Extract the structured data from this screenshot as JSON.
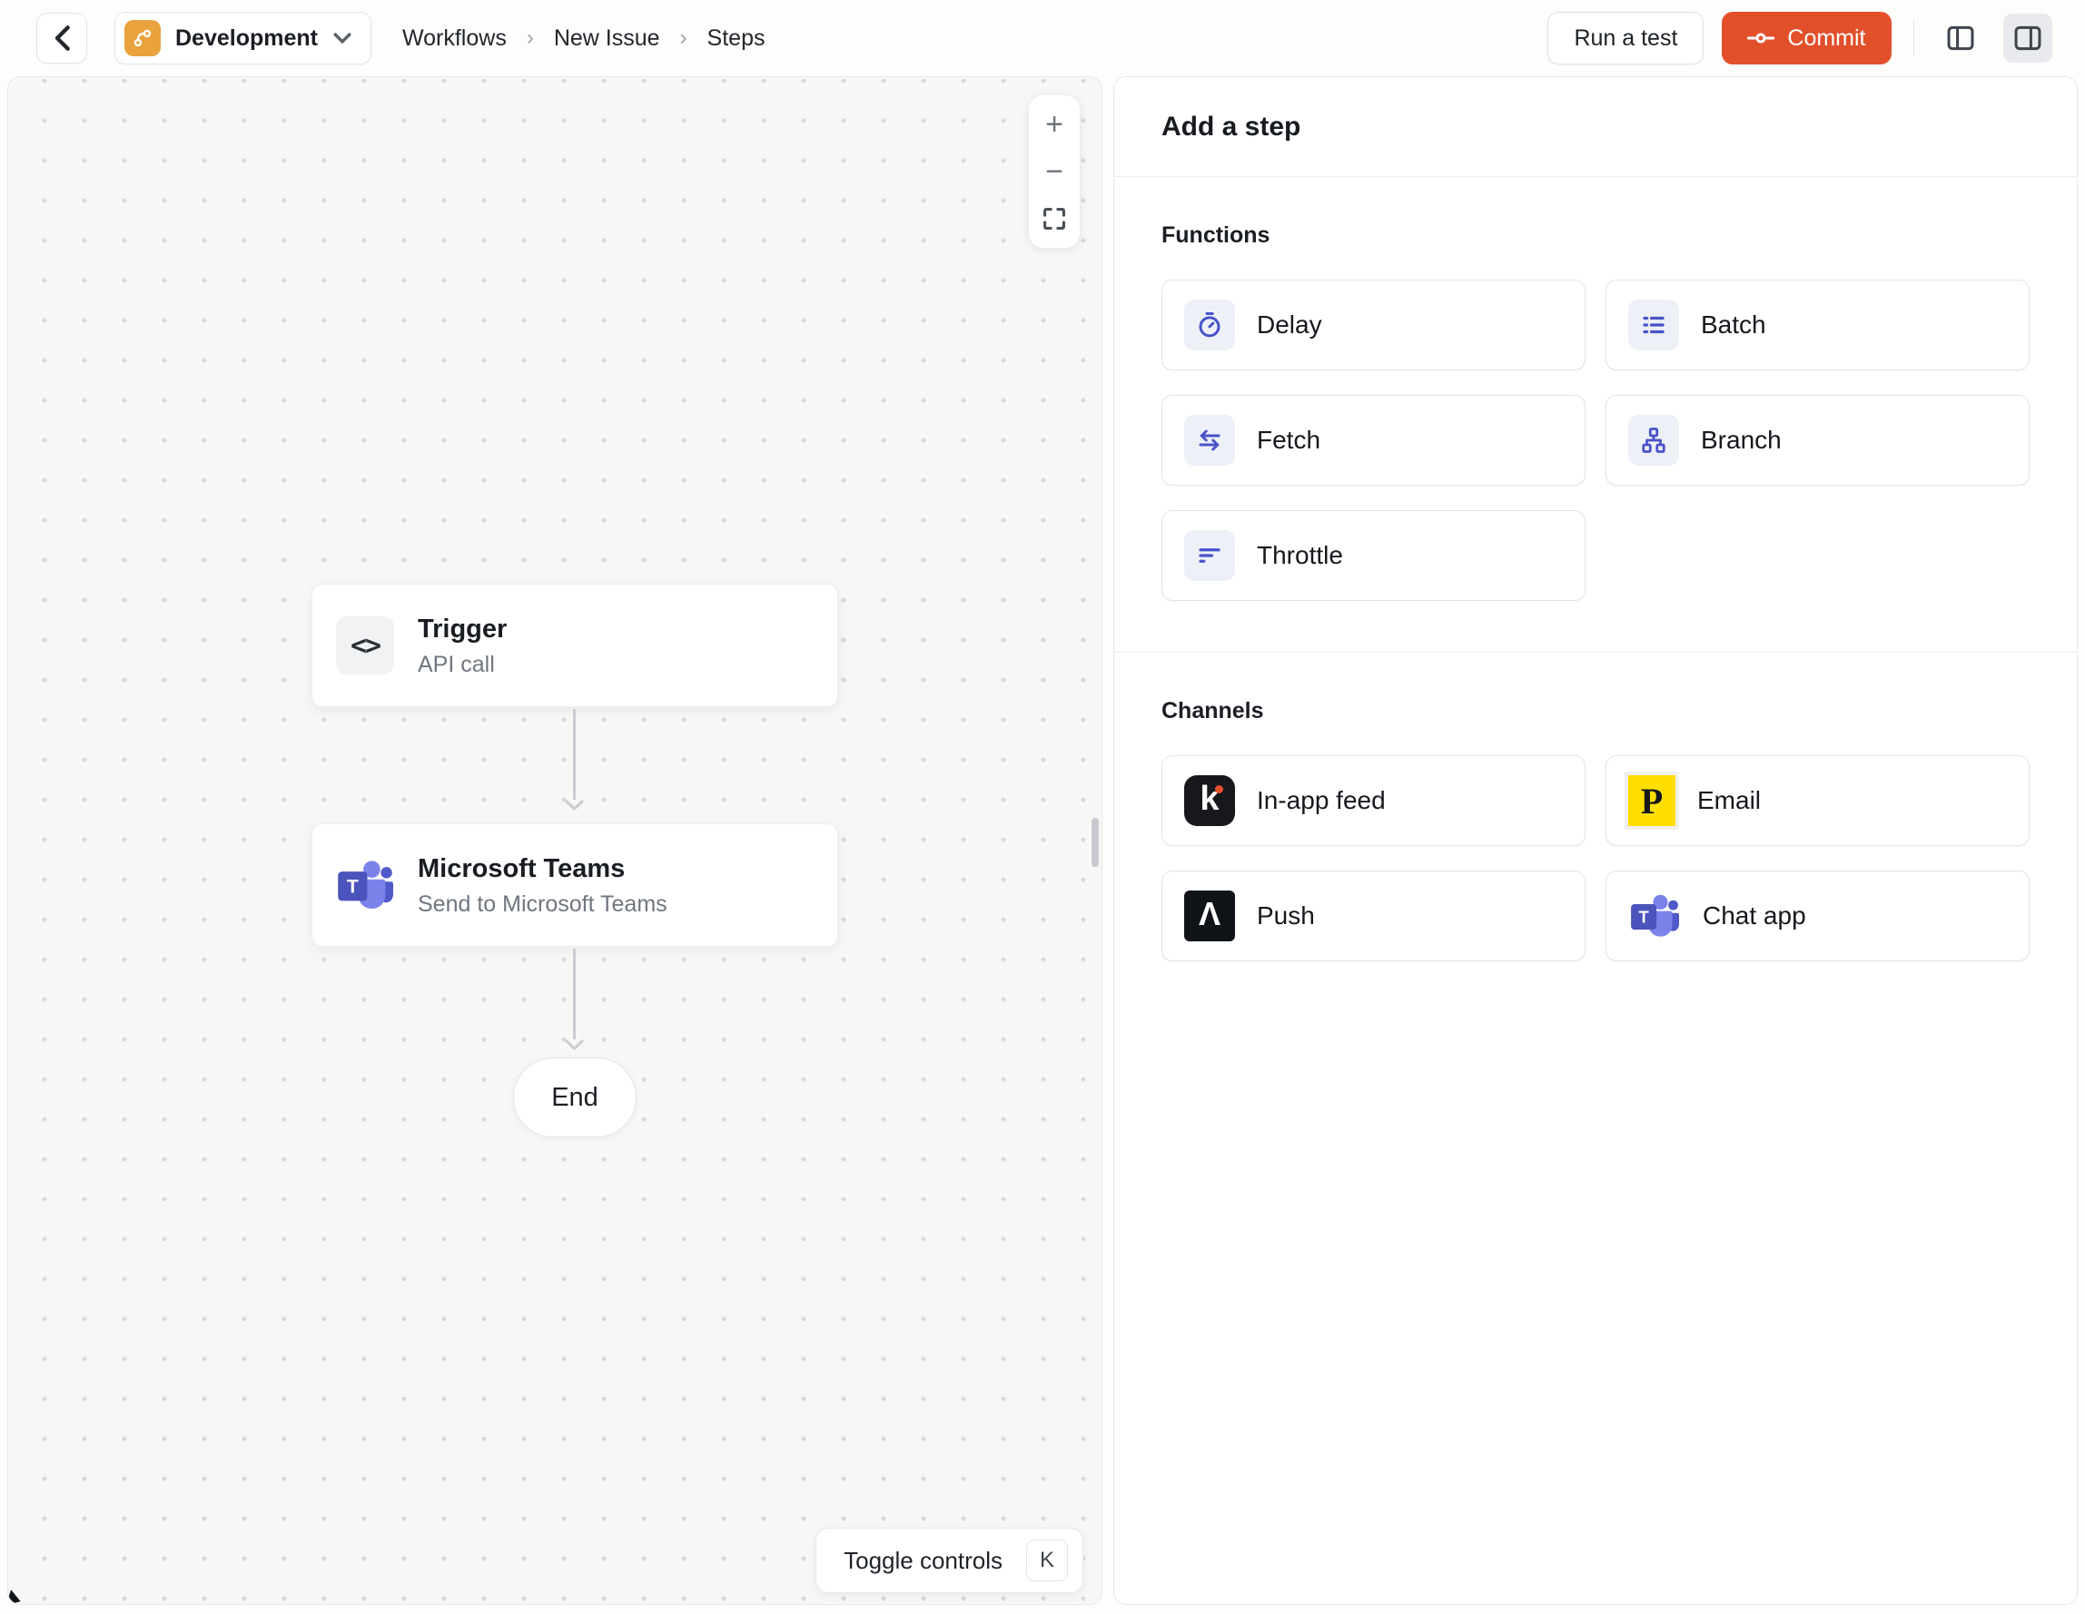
{
  "topbar": {
    "environment": {
      "label": "Development"
    },
    "breadcrumb": [
      "Workflows",
      "New Issue",
      "Steps"
    ],
    "run_test_label": "Run a test",
    "commit_label": "Commit"
  },
  "canvas": {
    "zoom_controls": {
      "zoom_in": "+",
      "zoom_out": "−"
    },
    "nodes": [
      {
        "title": "Trigger",
        "subtitle": "API call",
        "icon": "code-icon"
      },
      {
        "title": "Microsoft Teams",
        "subtitle": "Send to Microsoft Teams",
        "icon": "microsoft-teams-icon"
      }
    ],
    "end_label": "End",
    "toggle_controls": {
      "label": "Toggle controls",
      "shortcut": "K"
    }
  },
  "panel": {
    "title": "Add a step",
    "sections": [
      {
        "label": "Functions",
        "items": [
          {
            "label": "Delay",
            "icon": "stopwatch-icon"
          },
          {
            "label": "Batch",
            "icon": "list-icon"
          },
          {
            "label": "Fetch",
            "icon": "swap-arrows-icon"
          },
          {
            "label": "Branch",
            "icon": "tree-branch-icon"
          },
          {
            "label": "Throttle",
            "icon": "filter-lines-icon"
          }
        ]
      },
      {
        "label": "Channels",
        "items": [
          {
            "label": "In-app feed",
            "icon": "knock-logo"
          },
          {
            "label": "Email",
            "icon": "postmark-logo"
          },
          {
            "label": "Push",
            "icon": "expo-logo"
          },
          {
            "label": "Chat app",
            "icon": "microsoft-teams-icon"
          }
        ]
      }
    ]
  },
  "icons": {
    "code_glyph": "<>",
    "knock_k": "k",
    "postmark_p": "P",
    "expo_caret": "Λ"
  },
  "colors": {
    "commit_orange": "#E2502B",
    "environment_amber": "#E9A23C",
    "accent_indigo": "#4853C8",
    "teams_purple": "#4B53BC",
    "postmark_yellow": "#FFDE00"
  }
}
